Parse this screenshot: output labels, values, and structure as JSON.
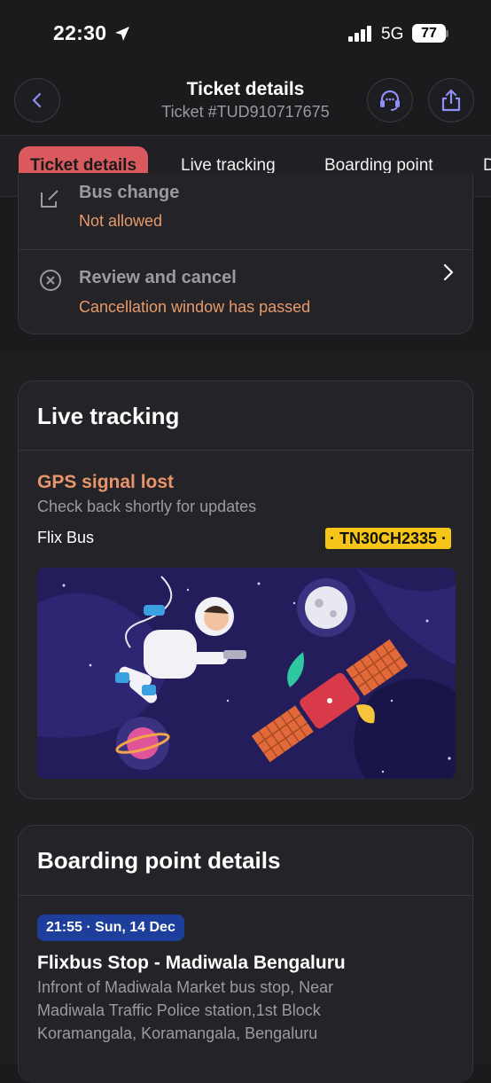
{
  "status_bar": {
    "time": "22:30",
    "network": "5G",
    "battery": "77"
  },
  "header": {
    "title": "Ticket details",
    "subtitle": "Ticket #TUD910717675"
  },
  "tabs": [
    {
      "label": "Ticket details",
      "active": true
    },
    {
      "label": "Live tracking"
    },
    {
      "label": "Boarding point"
    },
    {
      "label": "D"
    }
  ],
  "actions": {
    "bus_change": {
      "title": "Bus change",
      "status": "Not allowed"
    },
    "review_cancel": {
      "title": "Review and cancel",
      "status": "Cancellation window has passed"
    }
  },
  "live_tracking": {
    "heading": "Live tracking",
    "status": "GPS signal lost",
    "message": "Check back shortly for updates",
    "operator": "Flix Bus",
    "plate": "· TN30CH2335 ·"
  },
  "boarding": {
    "heading": "Boarding point details",
    "time_badge": "21:55 · Sun, 14 Dec",
    "stop_name": "Flixbus Stop - Madiwala Bengaluru",
    "address_line1": "Infront of Madiwala Market bus stop, Near",
    "address_line2": "Madiwala Traffic Police station,1st Block",
    "address_line3": "Koramangala, Koramangala, Bengaluru"
  },
  "colors": {
    "accent_tab": "#d9595e",
    "warning": "#e89a6a",
    "plate_bg": "#f5c518",
    "badge_bg": "#1d3e9a"
  }
}
